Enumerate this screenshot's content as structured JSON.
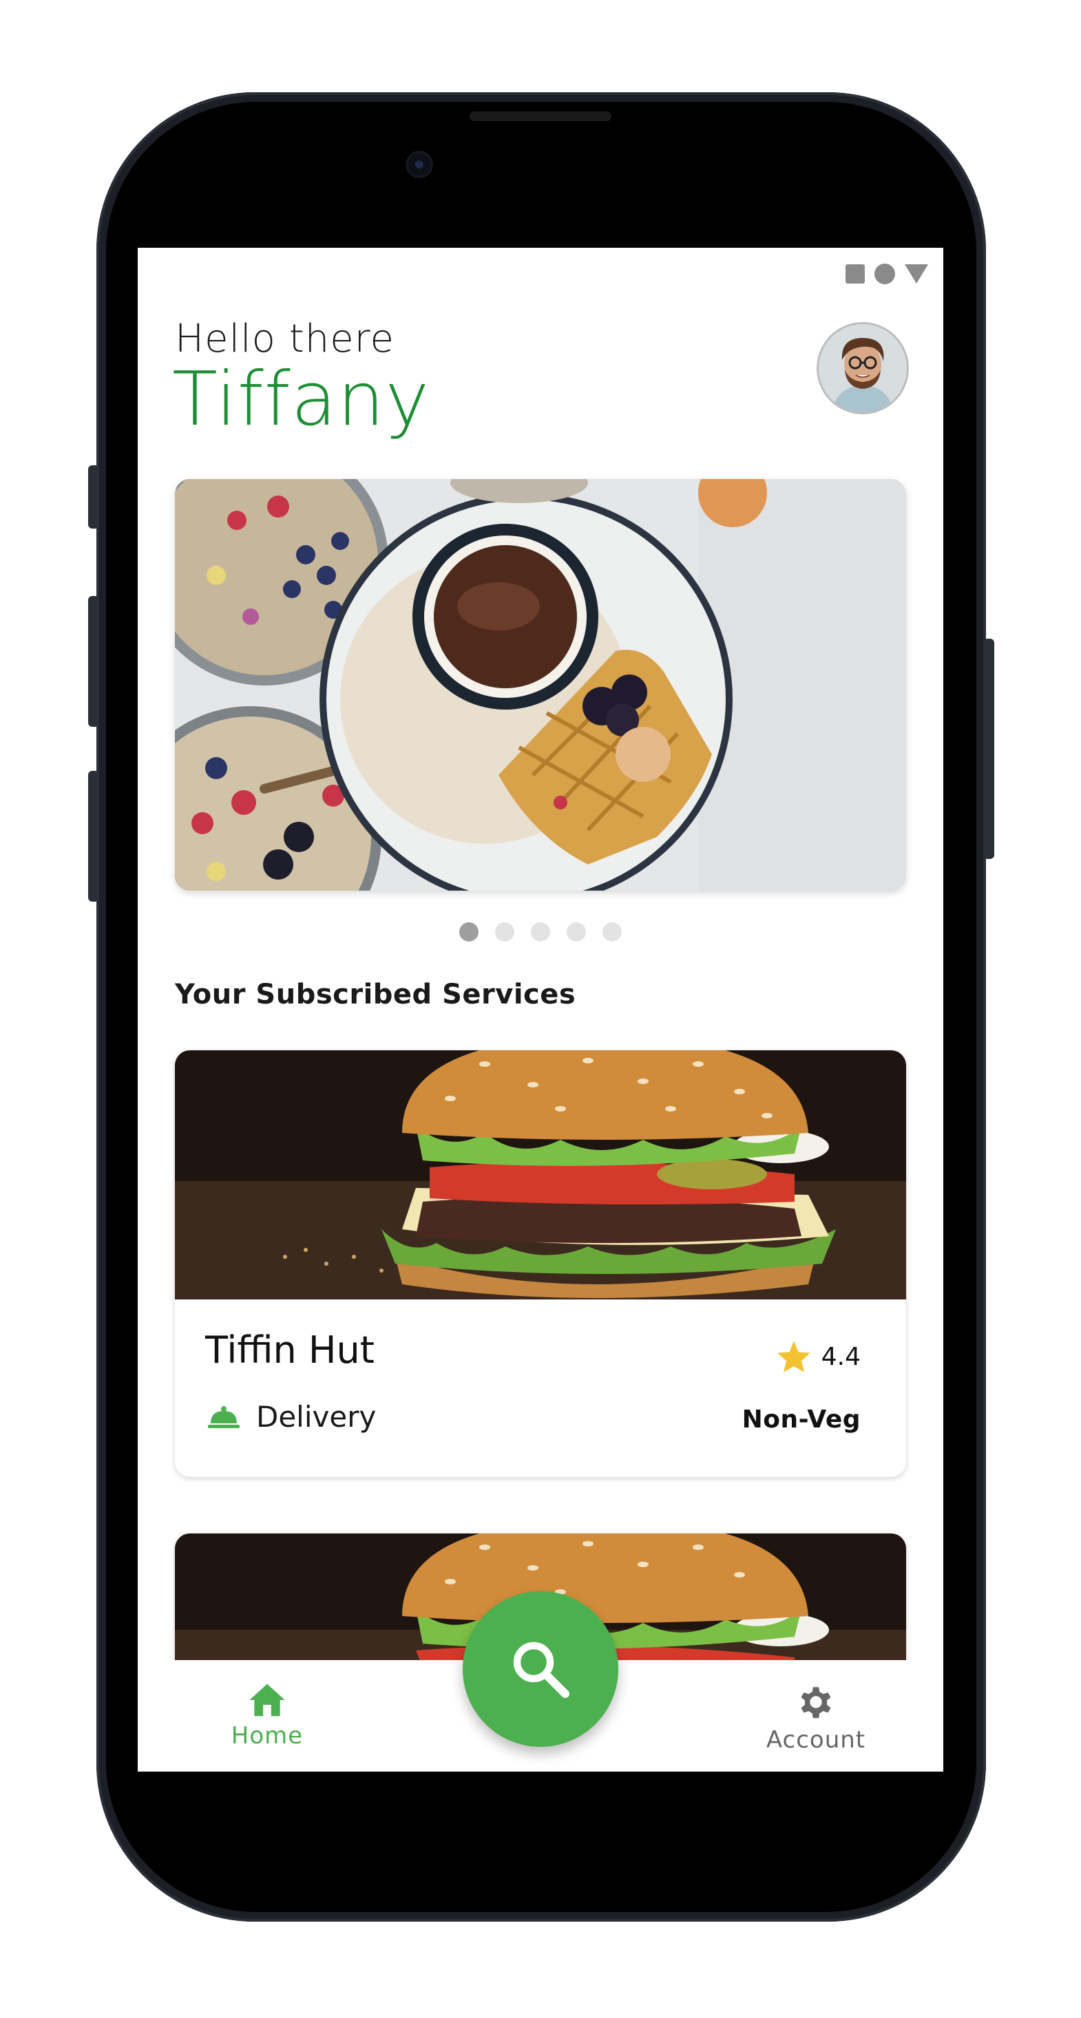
{
  "header": {
    "greeting": "Hello there",
    "username": "Tiffany"
  },
  "carousel": {
    "slide_count": 5,
    "active_index": 0
  },
  "subscribed": {
    "title": "Your Subscribed Services",
    "services": [
      {
        "name": "Tiffin Hut",
        "rating": "4.4",
        "service_type": "Delivery",
        "diet": "Non-Veg"
      }
    ]
  },
  "bottom_nav": {
    "home_label": "Home",
    "account_label": "Account",
    "active": "Home"
  },
  "colors": {
    "accent": "#4caf50",
    "username": "#1e8e35",
    "star": "#f2c230"
  },
  "icons": [
    "home-icon",
    "search-icon",
    "gear-icon",
    "star-icon",
    "cloche-icon"
  ]
}
